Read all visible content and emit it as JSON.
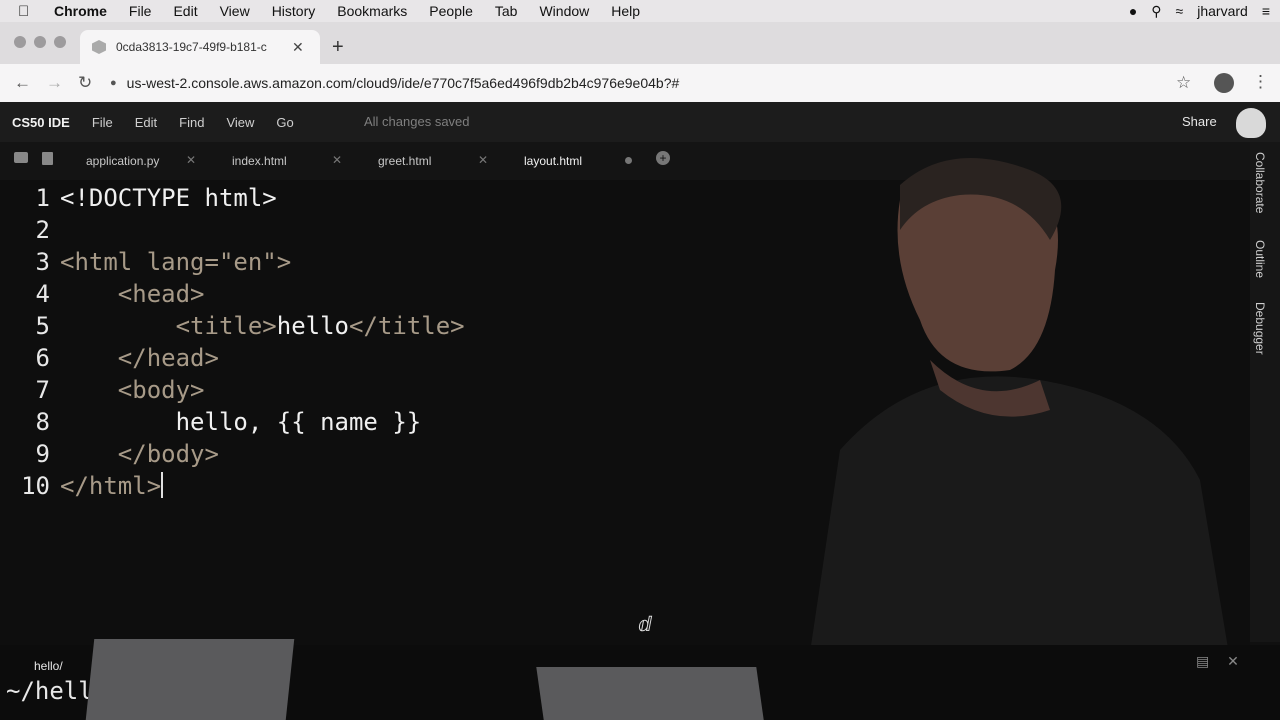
{
  "macos_menubar": {
    "app": "Chrome",
    "items": [
      "File",
      "Edit",
      "View",
      "History",
      "Bookmarks",
      "People",
      "Tab",
      "Window",
      "Help"
    ],
    "user": "jharvard"
  },
  "browser": {
    "tab_title": "0cda3813-19c7-49f9-b181-c",
    "url": "us-west-2.console.aws.amazon.com/cloud9/ide/e770c7f5a6ed496f9db2b4c976e9e04b?#"
  },
  "ide": {
    "brand": "CS50 IDE",
    "menus": [
      "File",
      "Edit",
      "Find",
      "View",
      "Go"
    ],
    "status": "All changes saved",
    "share_label": "Share",
    "editor_tabs": [
      "application.py",
      "index.html",
      "greet.html",
      "layout.html"
    ],
    "side_panels": [
      "Collaborate",
      "Outline",
      "Debugger"
    ],
    "code_lines": [
      {
        "num": "1",
        "text": "<!DOCTYPE html>"
      },
      {
        "num": "2",
        "text": ""
      },
      {
        "num": "3",
        "text": "<html lang=\"en\">"
      },
      {
        "num": "4",
        "text": "    <head>"
      },
      {
        "num": "5",
        "text": "        <title>hello</title>"
      },
      {
        "num": "6",
        "text": "    </head>"
      },
      {
        "num": "7",
        "text": "    <body>"
      },
      {
        "num": "8",
        "text": "        hello, {{ name }}"
      },
      {
        "num": "9",
        "text": "    </body>"
      },
      {
        "num": "10",
        "text": "</html>"
      }
    ],
    "terminal": {
      "tab_label": "hello/",
      "prompt": "~/hell"
    }
  },
  "icons": {
    "apple": "apple-icon",
    "wifi": "wifi-icon",
    "search": "search-icon",
    "lock": "lock-icon",
    "star": "star-icon"
  }
}
